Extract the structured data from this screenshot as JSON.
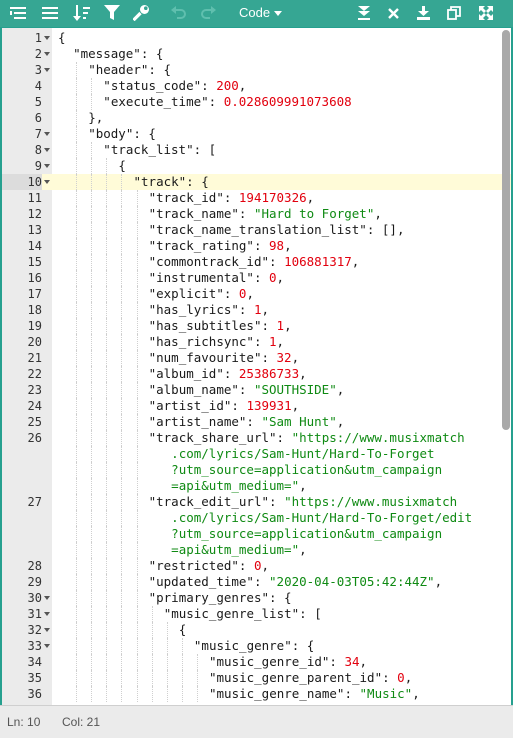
{
  "toolbar": {
    "mode_label": "Code",
    "icons": [
      "format-icon",
      "compact-icon",
      "sort-icon",
      "filter-icon",
      "repair-icon",
      "undo-icon",
      "redo-icon",
      "expand-all-icon",
      "close-icon",
      "download-icon",
      "duplicate-icon",
      "fullscreen-icon"
    ]
  },
  "status": {
    "line": "Ln: 10",
    "col": "Col: 21"
  },
  "colors": {
    "accent": "#36a693",
    "string": "#0f8a13",
    "number": "#e2000e",
    "active_line": "#fffbd8"
  },
  "editor": {
    "lines": [
      {
        "n": "1",
        "fold": true,
        "ind": 0,
        "seg": [
          [
            "k",
            "{"
          ]
        ]
      },
      {
        "n": "2",
        "fold": true,
        "ind": 1,
        "seg": [
          [
            "k",
            "\"message\": {"
          ]
        ]
      },
      {
        "n": "3",
        "fold": true,
        "ind": 2,
        "seg": [
          [
            "k",
            "\"header\": {"
          ]
        ]
      },
      {
        "n": "4",
        "fold": false,
        "ind": 3,
        "seg": [
          [
            "k",
            "\"status_code\": "
          ],
          [
            "n",
            "200"
          ],
          [
            "k",
            ","
          ]
        ]
      },
      {
        "n": "5",
        "fold": false,
        "ind": 3,
        "seg": [
          [
            "k",
            "\"execute_time\": "
          ],
          [
            "n",
            "0.028609991073608"
          ]
        ]
      },
      {
        "n": "6",
        "fold": false,
        "ind": 2,
        "seg": [
          [
            "k",
            "},"
          ]
        ]
      },
      {
        "n": "7",
        "fold": true,
        "ind": 2,
        "seg": [
          [
            "k",
            "\"body\": {"
          ]
        ]
      },
      {
        "n": "8",
        "fold": true,
        "ind": 3,
        "seg": [
          [
            "k",
            "\"track_list\": ["
          ]
        ]
      },
      {
        "n": "9",
        "fold": true,
        "ind": 4,
        "seg": [
          [
            "k",
            "{"
          ]
        ]
      },
      {
        "n": "10",
        "fold": true,
        "ind": 5,
        "active": true,
        "seg": [
          [
            "k",
            "\"track\": {"
          ]
        ]
      },
      {
        "n": "11",
        "fold": false,
        "ind": 6,
        "seg": [
          [
            "k",
            "\"track_id\": "
          ],
          [
            "n",
            "194170326"
          ],
          [
            "k",
            ","
          ]
        ]
      },
      {
        "n": "12",
        "fold": false,
        "ind": 6,
        "seg": [
          [
            "k",
            "\"track_name\": "
          ],
          [
            "s",
            "\"Hard to Forget\""
          ],
          [
            "k",
            ","
          ]
        ]
      },
      {
        "n": "13",
        "fold": false,
        "ind": 6,
        "seg": [
          [
            "k",
            "\"track_name_translation_list\": [],"
          ]
        ]
      },
      {
        "n": "14",
        "fold": false,
        "ind": 6,
        "seg": [
          [
            "k",
            "\"track_rating\": "
          ],
          [
            "n",
            "98"
          ],
          [
            "k",
            ","
          ]
        ]
      },
      {
        "n": "15",
        "fold": false,
        "ind": 6,
        "seg": [
          [
            "k",
            "\"commontrack_id\": "
          ],
          [
            "n",
            "106881317"
          ],
          [
            "k",
            ","
          ]
        ]
      },
      {
        "n": "16",
        "fold": false,
        "ind": 6,
        "seg": [
          [
            "k",
            "\"instrumental\": "
          ],
          [
            "n",
            "0"
          ],
          [
            "k",
            ","
          ]
        ]
      },
      {
        "n": "17",
        "fold": false,
        "ind": 6,
        "seg": [
          [
            "k",
            "\"explicit\": "
          ],
          [
            "n",
            "0"
          ],
          [
            "k",
            ","
          ]
        ]
      },
      {
        "n": "18",
        "fold": false,
        "ind": 6,
        "seg": [
          [
            "k",
            "\"has_lyrics\": "
          ],
          [
            "n",
            "1"
          ],
          [
            "k",
            ","
          ]
        ]
      },
      {
        "n": "19",
        "fold": false,
        "ind": 6,
        "seg": [
          [
            "k",
            "\"has_subtitles\": "
          ],
          [
            "n",
            "1"
          ],
          [
            "k",
            ","
          ]
        ]
      },
      {
        "n": "20",
        "fold": false,
        "ind": 6,
        "seg": [
          [
            "k",
            "\"has_richsync\": "
          ],
          [
            "n",
            "1"
          ],
          [
            "k",
            ","
          ]
        ]
      },
      {
        "n": "21",
        "fold": false,
        "ind": 6,
        "seg": [
          [
            "k",
            "\"num_favourite\": "
          ],
          [
            "n",
            "32"
          ],
          [
            "k",
            ","
          ]
        ]
      },
      {
        "n": "22",
        "fold": false,
        "ind": 6,
        "seg": [
          [
            "k",
            "\"album_id\": "
          ],
          [
            "n",
            "25386733"
          ],
          [
            "k",
            ","
          ]
        ]
      },
      {
        "n": "23",
        "fold": false,
        "ind": 6,
        "seg": [
          [
            "k",
            "\"album_name\": "
          ],
          [
            "s",
            "\"SOUTHSIDE\""
          ],
          [
            "k",
            ","
          ]
        ]
      },
      {
        "n": "24",
        "fold": false,
        "ind": 6,
        "seg": [
          [
            "k",
            "\"artist_id\": "
          ],
          [
            "n",
            "139931"
          ],
          [
            "k",
            ","
          ]
        ]
      },
      {
        "n": "25",
        "fold": false,
        "ind": 6,
        "seg": [
          [
            "k",
            "\"artist_name\": "
          ],
          [
            "s",
            "\"Sam Hunt\""
          ],
          [
            "k",
            ","
          ]
        ]
      },
      {
        "n": "26",
        "fold": false,
        "ind": 6,
        "seg": [
          [
            "k",
            "\"track_share_url\": "
          ],
          [
            "s",
            "\"https://www.musixmatch"
          ]
        ]
      },
      {
        "n": "",
        "fold": false,
        "ind": 6,
        "seg": [
          [
            "s",
            "   .com/lyrics/Sam-Hunt/Hard-To-Forget"
          ]
        ]
      },
      {
        "n": "",
        "fold": false,
        "ind": 6,
        "seg": [
          [
            "s",
            "   ?utm_source=application&utm_campaign"
          ]
        ]
      },
      {
        "n": "",
        "fold": false,
        "ind": 6,
        "seg": [
          [
            "s",
            "   =api&utm_medium=\""
          ],
          [
            "k",
            ","
          ]
        ]
      },
      {
        "n": "27",
        "fold": false,
        "ind": 6,
        "seg": [
          [
            "k",
            "\"track_edit_url\": "
          ],
          [
            "s",
            "\"https://www.musixmatch"
          ]
        ]
      },
      {
        "n": "",
        "fold": false,
        "ind": 6,
        "seg": [
          [
            "s",
            "   .com/lyrics/Sam-Hunt/Hard-To-Forget/edit"
          ]
        ]
      },
      {
        "n": "",
        "fold": false,
        "ind": 6,
        "seg": [
          [
            "s",
            "   ?utm_source=application&utm_campaign"
          ]
        ]
      },
      {
        "n": "",
        "fold": false,
        "ind": 6,
        "seg": [
          [
            "s",
            "   =api&utm_medium=\""
          ],
          [
            "k",
            ","
          ]
        ]
      },
      {
        "n": "28",
        "fold": false,
        "ind": 6,
        "seg": [
          [
            "k",
            "\"restricted\": "
          ],
          [
            "n",
            "0"
          ],
          [
            "k",
            ","
          ]
        ]
      },
      {
        "n": "29",
        "fold": false,
        "ind": 6,
        "seg": [
          [
            "k",
            "\"updated_time\": "
          ],
          [
            "s",
            "\"2020-04-03T05:42:44Z\""
          ],
          [
            "k",
            ","
          ]
        ]
      },
      {
        "n": "30",
        "fold": true,
        "ind": 6,
        "seg": [
          [
            "k",
            "\"primary_genres\": {"
          ]
        ]
      },
      {
        "n": "31",
        "fold": true,
        "ind": 7,
        "seg": [
          [
            "k",
            "\"music_genre_list\": ["
          ]
        ]
      },
      {
        "n": "32",
        "fold": true,
        "ind": 8,
        "seg": [
          [
            "k",
            "{"
          ]
        ]
      },
      {
        "n": "33",
        "fold": true,
        "ind": 9,
        "seg": [
          [
            "k",
            "\"music_genre\": {"
          ]
        ]
      },
      {
        "n": "34",
        "fold": false,
        "ind": 10,
        "seg": [
          [
            "k",
            "\"music_genre_id\": "
          ],
          [
            "n",
            "34"
          ],
          [
            "k",
            ","
          ]
        ]
      },
      {
        "n": "35",
        "fold": false,
        "ind": 10,
        "seg": [
          [
            "k",
            "\"music_genre_parent_id\": "
          ],
          [
            "n",
            "0"
          ],
          [
            "k",
            ","
          ]
        ]
      },
      {
        "n": "36",
        "fold": false,
        "ind": 10,
        "seg": [
          [
            "k",
            "\"music_genre_name\": "
          ],
          [
            "s",
            "\"Music\""
          ],
          [
            "k",
            ","
          ]
        ]
      }
    ]
  }
}
